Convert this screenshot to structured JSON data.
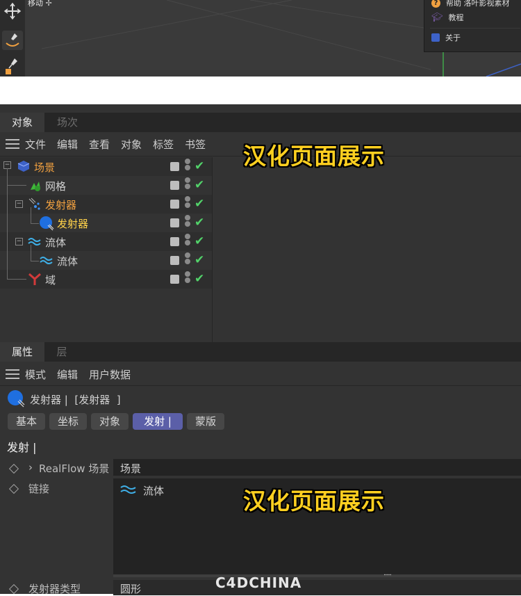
{
  "viewport": {
    "mode_label": "移动",
    "help_menu": [
      {
        "icon": "help-icon",
        "label": "帮助 洛叶影视素材"
      },
      {
        "icon": "tutorial-icon",
        "label": "教程"
      },
      {
        "icon": "about-icon",
        "label": "关于"
      }
    ]
  },
  "object_manager": {
    "tabs": [
      {
        "label": "对象",
        "active": true
      },
      {
        "label": "场次",
        "active": false
      }
    ],
    "menu": [
      "文件",
      "编辑",
      "查看",
      "对象",
      "标签",
      "书签"
    ],
    "tree": [
      {
        "label": "场景",
        "icon": "scene-icon",
        "color": "orange"
      },
      {
        "label": "网格",
        "icon": "mesh-icon",
        "color": "normal"
      },
      {
        "label": "发射器",
        "icon": "emitter-group-icon",
        "color": "orange"
      },
      {
        "label": "发射器",
        "icon": "emitter-icon",
        "color": "yellow"
      },
      {
        "label": "流体",
        "icon": "fluid-icon",
        "color": "normal"
      },
      {
        "label": "流体",
        "icon": "fluid-icon",
        "color": "normal"
      },
      {
        "label": "域",
        "icon": "domain-icon",
        "color": "normal"
      }
    ],
    "overlay_caption": "汉化页面展示"
  },
  "attribute_manager": {
    "tabs": [
      {
        "label": "属性",
        "active": true
      },
      {
        "label": "层",
        "active": false
      }
    ],
    "menu": [
      "模式",
      "编辑",
      "用户数据"
    ],
    "object_title": "发射器 |  [发射器  ]",
    "sub_tabs": [
      {
        "label": "基本",
        "active": false
      },
      {
        "label": "坐标",
        "active": false
      },
      {
        "label": "对象",
        "active": false
      },
      {
        "label": "发射 |",
        "active": true
      },
      {
        "label": "蒙版",
        "active": false
      }
    ],
    "section_title": "发射 |",
    "fields": {
      "realflow_scene_label": "RealFlow 场景",
      "realflow_scene_value": "场景",
      "link_label": "链接",
      "link_item": "流体",
      "emitter_type_label": "发射器类型",
      "emitter_type_value": "圆形",
      "resize_dots": "....."
    },
    "overlay_caption": "汉化页面展示"
  },
  "watermark": "C4DCHINA"
}
